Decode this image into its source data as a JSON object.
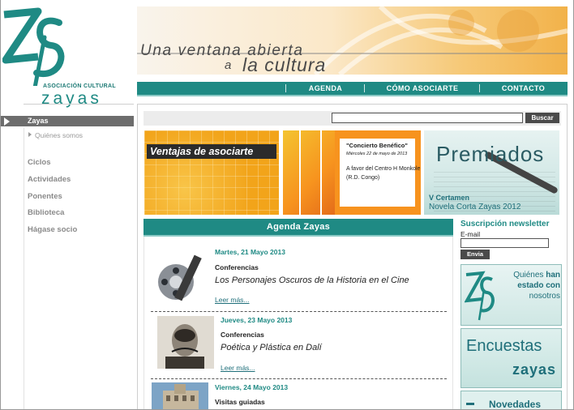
{
  "logo": {
    "subtitle": "ASOCIACIÓN CULTURAL",
    "name": "zayas"
  },
  "banner": {
    "line1": "Una ventana abierta",
    "line2_small": "a",
    "line2_big": "la cultura"
  },
  "topnav": {
    "items": [
      "AGENDA",
      "CÓMO ASOCIARTE",
      "CONTACTO"
    ]
  },
  "sidebar": {
    "active": "Zayas",
    "sub": "Quiénes somos",
    "items": [
      "Ciclos",
      "Actividades",
      "Ponentes",
      "Biblioteca",
      "Hágase socio"
    ]
  },
  "search": {
    "value": "",
    "placeholder": "",
    "button": "Buscar"
  },
  "promos": {
    "p1": {
      "label": "Ventajas de asociarte"
    },
    "p2": {
      "title": "\"Concierto Benéfico\"",
      "date": "Miércoles 22 de mayo de 2013",
      "text": "A favor del Centro H Monkole (R.D. Congo)"
    },
    "p3": {
      "title": "Premiados",
      "sub1": "V Certamen",
      "sub2": "Novela Corta Zayas 2012"
    }
  },
  "agenda": {
    "title": "Agenda Zayas",
    "events": [
      {
        "date": "Martes, 21 Mayo 2013",
        "category": "Conferencias",
        "title": "Los Personajes Oscuros de la Historia en el Cine",
        "more": "Leer más..."
      },
      {
        "date": "Jueves, 23 Mayo 2013",
        "category": "Conferencias",
        "title": "Poética y Plástica en Dalí",
        "more": "Leer más..."
      },
      {
        "date": "Viernes, 24 Mayo 2013",
        "category": "Visitas guiadas",
        "title": "",
        "more": ""
      }
    ]
  },
  "newsletter": {
    "title": "Suscripción newsletter",
    "label": "E-mail",
    "value": "",
    "button": "Envia"
  },
  "boxes": {
    "b1": {
      "line1_a": "Quiénes",
      "line1_b": "han",
      "line2": "estado con",
      "line3": "nosotros"
    },
    "b2": {
      "line1": "Encuestas",
      "line2": "zayas"
    },
    "b3": {
      "line1": "Novedades"
    }
  },
  "colors": {
    "teal": "#1f8a84",
    "teal_light": "#8ccac6",
    "gray_active": "#6d6d6d"
  }
}
